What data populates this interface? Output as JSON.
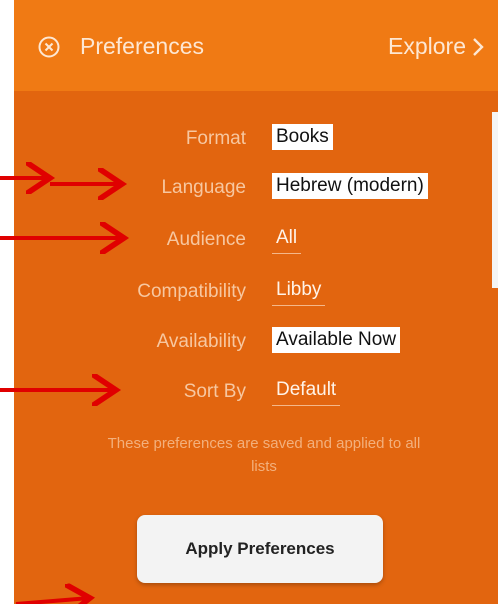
{
  "header": {
    "title": "Preferences",
    "explore_label": "Explore"
  },
  "preferences": [
    {
      "label": "Format",
      "value": "Books",
      "highlighted": true
    },
    {
      "label": "Language",
      "value": "Hebrew (modern)",
      "highlighted": true
    },
    {
      "label": "Audience",
      "value": "All",
      "highlighted": false
    },
    {
      "label": "Compatibility",
      "value": "Libby",
      "highlighted": false
    },
    {
      "label": "Availability",
      "value": "Available Now",
      "highlighted": true
    },
    {
      "label": "Sort By",
      "value": "Default",
      "highlighted": false
    }
  ],
  "note": "These preferences are saved and applied to all lists",
  "apply_label": "Apply Preferences",
  "colors": {
    "panel": "#e2650f",
    "header": "#f07a14",
    "annotation_arrow": "#e00000"
  }
}
